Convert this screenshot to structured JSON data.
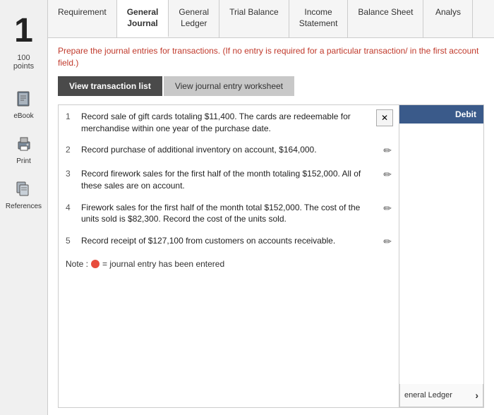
{
  "sidebar": {
    "number": "1",
    "points_label": "100",
    "points_text": "points",
    "items": [
      {
        "name": "eBook",
        "icon": "book"
      },
      {
        "name": "Print",
        "icon": "print"
      },
      {
        "name": "References",
        "icon": "references"
      }
    ]
  },
  "tabs": [
    {
      "label": "Requirement",
      "active": false
    },
    {
      "label": "General\nJournal",
      "active": true
    },
    {
      "label": "General\nLedger",
      "active": false
    },
    {
      "label": "Trial Balance",
      "active": false
    },
    {
      "label": "Income\nStatement",
      "active": false
    },
    {
      "label": "Balance Sheet",
      "active": false
    },
    {
      "label": "Analys",
      "active": false
    }
  ],
  "instruction": "Prepare the journal entries for transactions. (If no entry is required for a particular transaction/ in the first account field.)",
  "buttons": {
    "view_transaction": "View transaction list",
    "view_journal": "View journal entry worksheet"
  },
  "transactions": [
    {
      "num": "1",
      "text": "Record sale of gift cards totaling $11,400. The cards are redeemable for merchandise within one year of the purchase date."
    },
    {
      "num": "2",
      "text": "Record purchase of additional inventory on account, $164,000."
    },
    {
      "num": "3",
      "text": "Record firework sales for the first half of the month totaling $152,000. All of these sales are on account."
    },
    {
      "num": "4",
      "text": "Firework sales for the first half of the month total $152,000. The cost of the units sold is $82,300. Record the cost of the units sold."
    },
    {
      "num": "5",
      "text": "Record receipt of $127,100 from customers on accounts receivable."
    }
  ],
  "note": {
    "label": "Note :",
    "text": "= journal entry has been entered"
  },
  "right_panel": {
    "header": "Debit",
    "ledger_button": "eneral Ledger"
  },
  "expand_icon": "✕"
}
